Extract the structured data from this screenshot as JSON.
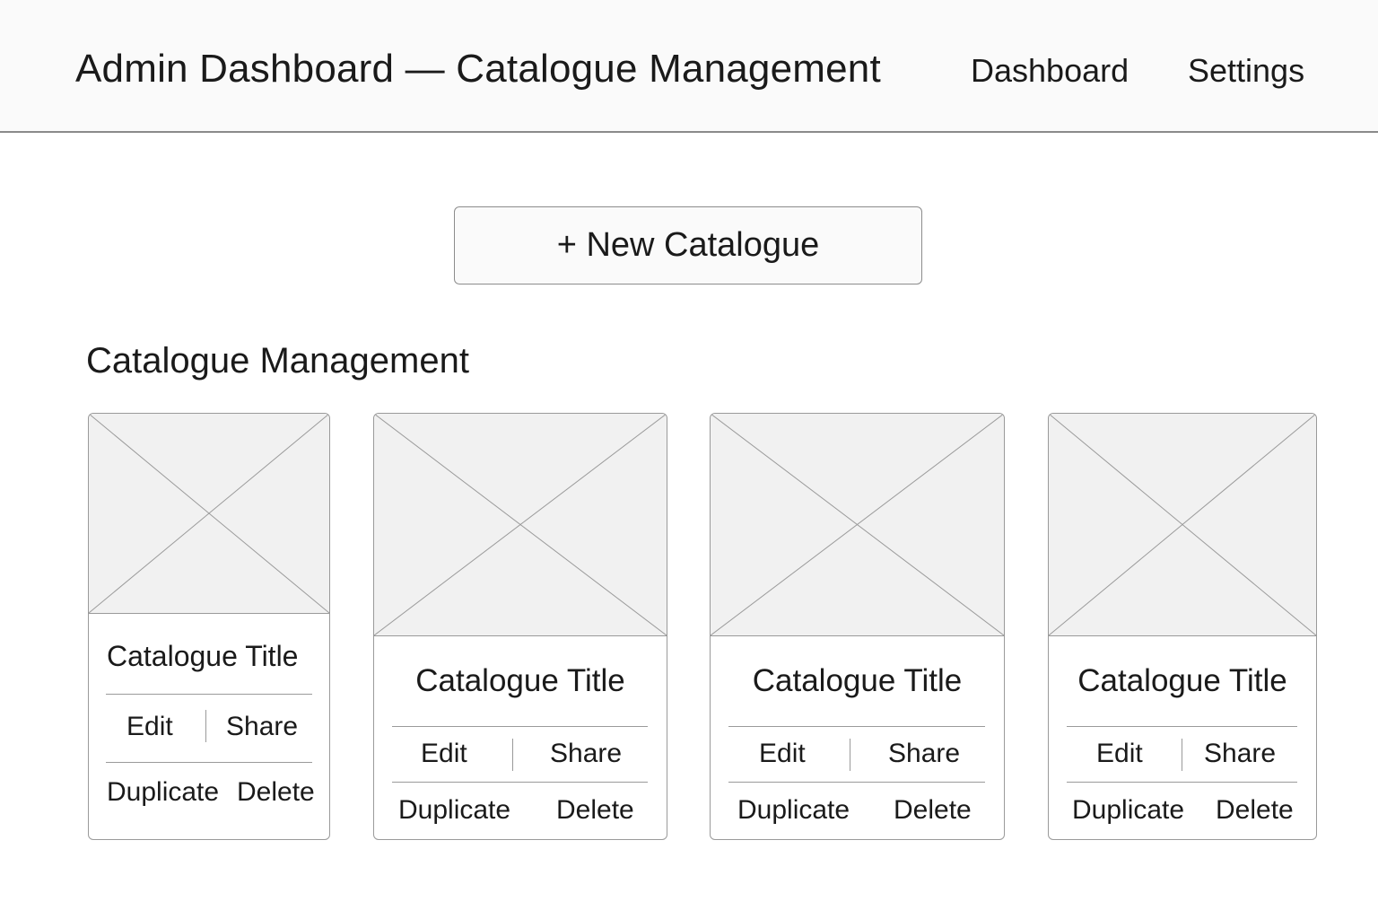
{
  "header": {
    "title": "Admin Dashboard — Catalogue Management",
    "nav": {
      "dashboard": "Dashboard",
      "settings": "Settings"
    }
  },
  "new_catalogue_button": "+ New Catalogue",
  "section_title": "Catalogue Management",
  "cards": [
    {
      "title": "Catalogue Title",
      "thumbnail": "image-placeholder-icon",
      "actions": {
        "edit": "Edit",
        "share": "Share",
        "duplicate": "Duplicate",
        "delete": "Delete"
      }
    },
    {
      "title": "Catalogue Title",
      "thumbnail": "image-placeholder-icon",
      "actions": {
        "edit": "Edit",
        "share": "Share",
        "duplicate": "Duplicate",
        "delete": "Delete"
      }
    },
    {
      "title": "Catalogue Title",
      "thumbnail": "image-placeholder-icon",
      "actions": {
        "edit": "Edit",
        "share": "Share",
        "duplicate": "Duplicate",
        "delete": "Delete"
      }
    },
    {
      "title": "Catalogue Title",
      "thumbnail": "image-placeholder-icon",
      "actions": {
        "edit": "Edit",
        "share": "Share",
        "duplicate": "Duplicate",
        "delete": "Delete"
      }
    }
  ],
  "colors": {
    "header_background": "#fafafa",
    "placeholder_fill": "#f1f1f1",
    "border": "#9a9a9a",
    "text": "#1a1a1a"
  }
}
